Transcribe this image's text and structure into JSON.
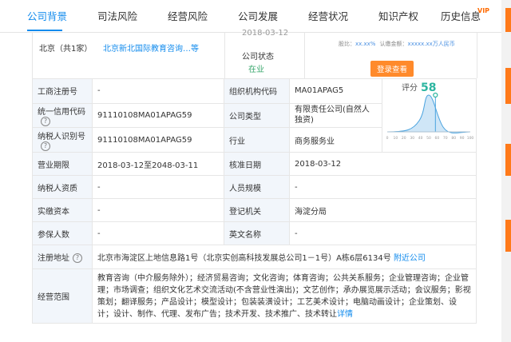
{
  "tabs": [
    {
      "label": "公司背景",
      "active": true
    },
    {
      "label": "司法风险",
      "active": false
    },
    {
      "label": "经营风险",
      "active": false
    },
    {
      "label": "公司发展",
      "active": false
    },
    {
      "label": "经营状况",
      "active": false
    },
    {
      "label": "知识产权",
      "active": false
    },
    {
      "label": "历史信息",
      "active": false
    }
  ],
  "vip_badge": "VIP",
  "top_section": {
    "region_text": "北京（共1家）",
    "region_company": "北京新北国际教育咨询…等",
    "date_partial": "2018-03-12",
    "status_label": "公司状态",
    "status_value": "在业",
    "shareholder_label": "股比：",
    "shareholder_value": "xx.xx%",
    "capital_label": "认缴金额：",
    "capital_value": "xxxxx.xx万人民币",
    "report_button": "登录查看"
  },
  "score": {
    "label": "评分",
    "value": 58,
    "axis": [
      "0",
      "10",
      "20",
      "30",
      "40",
      "50",
      "60",
      "70",
      "80",
      "90",
      "100"
    ],
    "marker_value": 58
  },
  "rows": [
    {
      "l1": "工商注册号",
      "v1": "-",
      "l2": "组织机构代码",
      "v2": "MA01APAG5"
    },
    {
      "l1": "统一信用代码",
      "v1": "91110108MA01APAG59",
      "l2": "公司类型",
      "v2": "有限责任公司(自然人独资)"
    },
    {
      "l1": "纳税人识别号",
      "v1": "91110108MA01APAG59",
      "l2": "行业",
      "v2": "商务服务业"
    },
    {
      "l1": "营业期限",
      "v1": "2018-03-12至2048-03-11",
      "l2": "核准日期",
      "v2": "2018-03-12"
    },
    {
      "l1": "纳税人资质",
      "v1": "-",
      "l2": "人员规模",
      "v2": "-"
    },
    {
      "l1": "实缴资本",
      "v1": "-",
      "l2": "登记机关",
      "v2": "海淀分局"
    },
    {
      "l1": "参保人数",
      "v1": "-",
      "l2": "英文名称",
      "v2": "-"
    }
  ],
  "address": {
    "label": "注册地址",
    "value": "北京市海淀区上地信息路1号（北京实创高科技发展总公司1－1号）A栋6层6134号",
    "link": "附近公司"
  },
  "scope": {
    "label": "经营范围",
    "value": "教育咨询（中介服务除外）；经济贸易咨询；文化咨询；体育咨询；公共关系服务；企业管理咨询；企业管理；市场调查；组织文化艺术交流活动(不含营业性演出)；文艺创作；承办展览展示活动；会议服务；影视策划；翻译服务；产品设计；模型设计；包装装潢设计；工艺美术设计；电脑动画设计；企业策划、设计；设计、制作、代理、发布广告；技术开发、技术推广、技术转让",
    "link": "详情"
  },
  "colors": {
    "accent": "#128bed",
    "label_bg": "#f2f6fb",
    "orange": "#ff8a2b",
    "status_green": "#3aa76d"
  }
}
